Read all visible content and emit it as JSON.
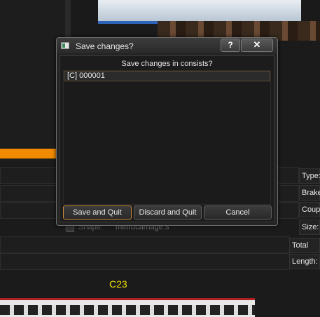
{
  "dialog": {
    "title": "Save changes?",
    "help_label": "?",
    "close_label": "✕",
    "message": "Save changes in consists?",
    "items": [
      "[C] 000001"
    ],
    "buttons": {
      "save_quit": "Save and Quit",
      "discard_quit": "Discard and Quit",
      "cancel": "Cancel"
    }
  },
  "background": {
    "properties": {
      "type_label": "Type:",
      "brake_label": "Brake",
      "coupling_label": "Coupl",
      "size_label": "Size:",
      "total_mass_label": "Total Ma",
      "length_label": "Length:",
      "shape_label": "Shape:",
      "shape_value": "metrocarriage.s"
    },
    "car_label": "C23"
  },
  "colors": {
    "accent_orange": "#f08a00",
    "label_yellow": "#f2e000",
    "train_blue": "#2f63b8"
  }
}
